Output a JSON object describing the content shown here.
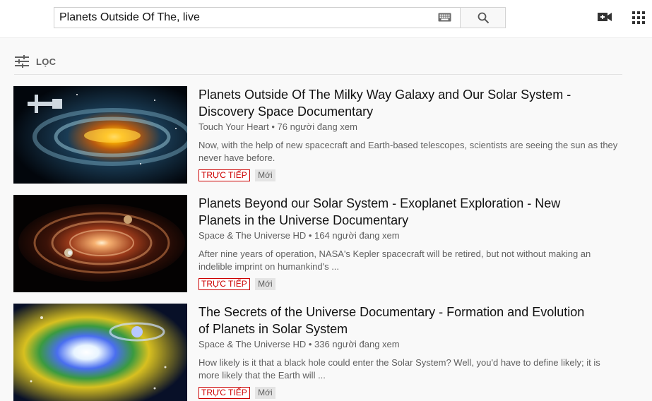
{
  "search": {
    "query": "Planets Outside Of The, live"
  },
  "icons": {
    "keyboard": "keyboard-icon",
    "search": "search-icon",
    "camera": "video-camera-add-icon",
    "apps": "apps-grid-icon",
    "filter": "filter-sliders-icon"
  },
  "filter": {
    "label": "LỌC"
  },
  "results": [
    {
      "title": "Planets Outside Of The Milky Way Galaxy and Our Solar System - Discovery Space Documentary",
      "channel": "Touch Your Heart",
      "viewers": "76 người đang xem",
      "description": "Now, with the help of new spacecraft and Earth-based telescopes, scientists are seeing the sun as they never have before.",
      "live_badge": "TRỰC TIẾP",
      "new_badge": "Mới"
    },
    {
      "title": "Planets Beyond our Solar System - Exoplanet Exploration - New Planets in the Universe Documentary",
      "channel": "Space & The Universe HD",
      "viewers": "164 người đang xem",
      "description": "After nine years of operation, NASA's Kepler spacecraft will be retired, but not without making an indelible imprint on humankind's ...",
      "live_badge": "TRỰC TIẾP",
      "new_badge": "Mới"
    },
    {
      "title": "The Secrets of the Universe Documentary - Formation and Evolution of Planets in Solar System",
      "channel": "Space & The Universe HD",
      "viewers": "336 người đang xem",
      "description": "How likely is it that a black hole could enter the Solar System? Well, you'd have to define likely; it is more likely that the Earth will ...",
      "live_badge": "TRỰC TIẾP",
      "new_badge": "Mới"
    }
  ],
  "separator": "•",
  "colors": {
    "live": "#cc0000",
    "text_secondary": "#606060",
    "background": "#f9f9f9"
  }
}
